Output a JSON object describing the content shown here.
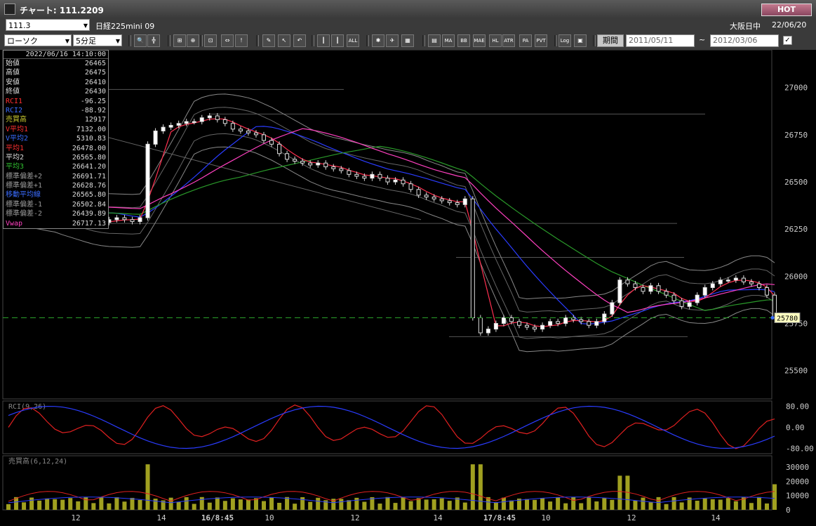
{
  "window": {
    "title": "チャート: 111.2209",
    "hot_label": "HOT"
  },
  "header": {
    "symbol_code": "111.3",
    "instrument": "日経225mini 09",
    "exchange_status": "大阪日中",
    "date": "22/06/20"
  },
  "toolbar": {
    "chart_type": "ローソク",
    "interval": "5分足",
    "period_label": "期間",
    "date_from": "2011/05/11",
    "date_to": "2012/03/06",
    "tilde": "~",
    "icons": [
      "zoom-icon",
      "crosshair-icon",
      "ruler-icon",
      "magnify-icon",
      "fit-icon",
      "arrows-icon",
      "warning-icon",
      "pencil-icon",
      "cursor-icon",
      "undo-icon",
      "bar-icon",
      "bar2-icon",
      "all-icon",
      "settings-icon",
      "wrench-icon",
      "palette-icon",
      "vwap-icon",
      "ma-icon",
      "bb-icon",
      "mae-icon",
      "hl-icon",
      "atr-icon",
      "para-icon",
      "pvt-icon",
      "log-icon",
      "export-icon"
    ],
    "icon_labels": {
      "all": "ALL",
      "ma": "MA",
      "bb": "BB",
      "mae": "MAE",
      "hl": "HL",
      "atr": "ATR",
      "para": "PA RA",
      "pvt": "PVT",
      "log": "Log"
    }
  },
  "info": {
    "timestamp": "2022/06/16  14:10:00",
    "rows": [
      {
        "label": "始値",
        "value": "26465",
        "color": "#dddddd"
      },
      {
        "label": "高値",
        "value": "26475",
        "color": "#dddddd"
      },
      {
        "label": "安値",
        "value": "26410",
        "color": "#dddddd"
      },
      {
        "label": "終値",
        "value": "26430",
        "color": "#dddddd"
      },
      {
        "label": "RCI1",
        "value": "-96.25",
        "color": "#ff3030"
      },
      {
        "label": "RCI2",
        "value": "-88.92",
        "color": "#3a6cff"
      },
      {
        "label": "売買高",
        "value": "12917",
        "color": "#c8c830"
      },
      {
        "label": "V平均1",
        "value": "7132.00",
        "color": "#ff3030"
      },
      {
        "label": "V平均2",
        "value": "5310.83",
        "color": "#3a6cff"
      },
      {
        "label": "平均1",
        "value": "26478.00",
        "color": "#ff3030"
      },
      {
        "label": "平均2",
        "value": "26565.80",
        "color": "#dddddd"
      },
      {
        "label": "平均3",
        "value": "26641.20",
        "color": "#30c030"
      },
      {
        "label": "標準偏差+2",
        "value": "26691.71",
        "color": "#999999"
      },
      {
        "label": "標準偏差+1",
        "value": "26628.76",
        "color": "#999999"
      },
      {
        "label": "移動平均線",
        "value": "26565.80",
        "color": "#3a6cff"
      },
      {
        "label": "標準偏差-1",
        "value": "26502.84",
        "color": "#999999"
      },
      {
        "label": "標準偏差-2",
        "value": "26439.89",
        "color": "#999999"
      },
      {
        "label": "Vwap",
        "value": "26717.13",
        "color": "#ff40c0"
      }
    ]
  },
  "chart_data": [
    {
      "type": "candlestick",
      "title": "",
      "ylim": [
        25350,
        27200
      ],
      "ytick_labels": [
        "27000",
        "26750",
        "26500",
        "26250",
        "26000",
        "25750",
        "25500"
      ],
      "yticks": [
        27000,
        26750,
        26500,
        26250,
        26000,
        25750,
        25500
      ],
      "current_price_label": "25780",
      "current_price": 25780,
      "xtick_labels": [
        "12",
        "14",
        "16/8:45",
        "10",
        "12",
        "14",
        "17/8:45",
        "10",
        "12",
        "14"
      ],
      "close_path": [
        26420,
        26400,
        26390,
        26380,
        26360,
        26340,
        26330,
        26320,
        26310,
        26300,
        26290,
        26280,
        26285,
        26300,
        26310,
        26300,
        26290,
        26310,
        26700,
        26770,
        26790,
        26800,
        26810,
        26820,
        26820,
        26840,
        26850,
        26830,
        26810,
        26780,
        26770,
        26760,
        26750,
        26720,
        26700,
        26650,
        26620,
        26610,
        26600,
        26590,
        26600,
        26580,
        26570,
        26560,
        26540,
        26530,
        26520,
        26540,
        26520,
        26500,
        26510,
        26490,
        26460,
        26430,
        26420,
        26410,
        26400,
        26390,
        26380,
        26410,
        25780,
        25700,
        25720,
        25750,
        25780,
        25760,
        25740,
        25730,
        25720,
        25740,
        25760,
        25750,
        25780,
        25770,
        25760,
        25740,
        25760,
        25800,
        25860,
        25980,
        25960,
        25940,
        25920,
        25950,
        25920,
        25900,
        25870,
        25840,
        25860,
        25900,
        25940,
        25960,
        25980,
        25980,
        25990,
        25970,
        25960,
        25940,
        25900,
        25780
      ]
    },
    {
      "type": "line",
      "title": "RCI(9,26)",
      "ylim": [
        -100,
        100
      ],
      "ytick_labels": [
        "80.00",
        "0.00",
        "-80.00"
      ],
      "yticks": [
        80,
        0,
        -80
      ],
      "series": []
    },
    {
      "type": "bar",
      "title": "売買高(6,12,24)",
      "ylim": [
        0,
        38000
      ],
      "ytick_labels": [
        "30000",
        "20000",
        "10000",
        "0"
      ],
      "yticks": [
        30000,
        20000,
        10000,
        0
      ],
      "series": []
    }
  ]
}
